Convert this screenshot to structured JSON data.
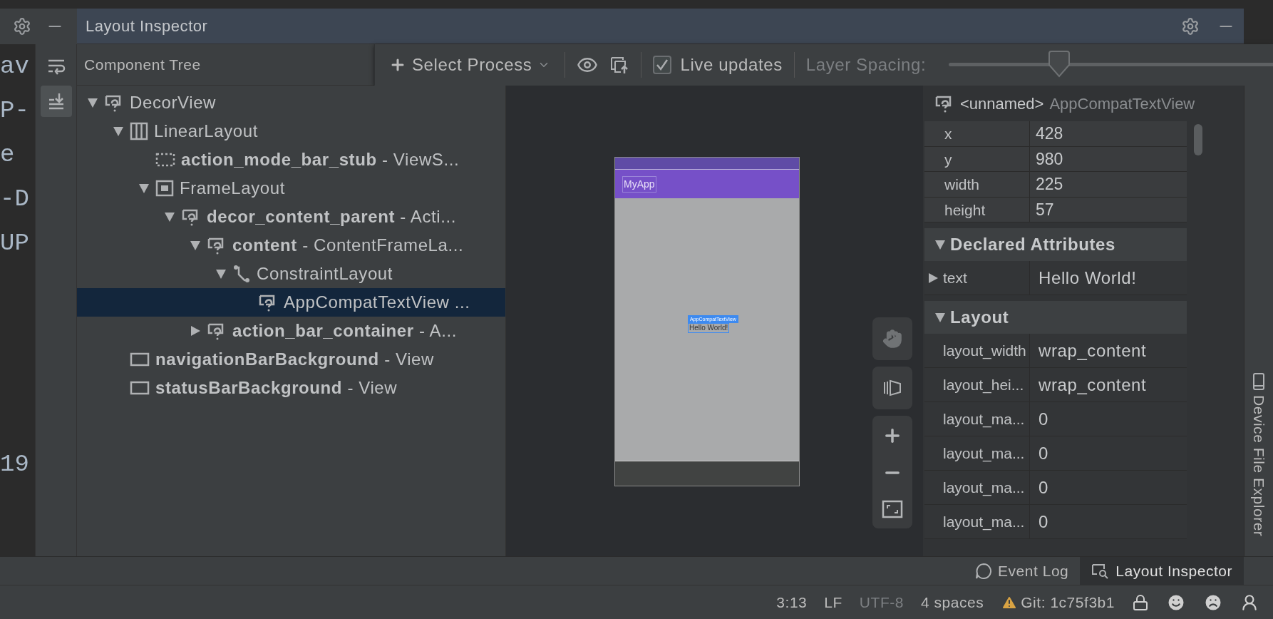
{
  "editor_fragments": [
    "av",
    "P-",
    "e",
    "-D",
    "UP",
    "19"
  ],
  "panel_title": "Layout Inspector",
  "component_tree": {
    "title": "Component Tree",
    "nodes": [
      {
        "label": "DecorView",
        "kind": "view",
        "expanded": true,
        "selected": false,
        "children": [
          {
            "label": "LinearLayout",
            "kind": "linear",
            "expanded": true,
            "selected": false,
            "children": [
              {
                "label": "**action_mode_bar_stub** - ViewS...",
                "kind": "stub",
                "selected": false
              },
              {
                "label": "FrameLayout",
                "kind": "frame",
                "expanded": true,
                "selected": false,
                "children": [
                  {
                    "label": "**decor_content_parent** - Acti...",
                    "kind": "view",
                    "expanded": true,
                    "selected": false,
                    "children": [
                      {
                        "label": "**content** - ContentFrameLa...",
                        "kind": "view",
                        "expanded": true,
                        "selected": false,
                        "children": [
                          {
                            "label": "ConstraintLayout",
                            "kind": "constraint",
                            "expanded": true,
                            "selected": false,
                            "children": [
                              {
                                "label": "AppCompatTextView ...",
                                "kind": "view",
                                "selected": true
                              }
                            ]
                          }
                        ]
                      },
                      {
                        "label": "**action_bar_container** - A...",
                        "kind": "view",
                        "expanded": false,
                        "selected": false
                      }
                    ]
                  }
                ]
              }
            ]
          },
          {
            "label": "**navigationBarBackground** - View",
            "kind": "rect",
            "selected": false
          },
          {
            "label": "**statusBarBackground** - View",
            "kind": "rect",
            "selected": false
          }
        ]
      }
    ]
  },
  "toolbar": {
    "select_process": "Select Process",
    "live_updates": {
      "label": "Live updates",
      "checked": true
    },
    "layer_spacing": {
      "label": "Layer Spacing:",
      "level": 0.3
    }
  },
  "device": {
    "app_title": "MyApp",
    "selection_tag": "AppCompatTextView",
    "text": "Hello World!"
  },
  "properties": {
    "header_id": "<unnamed>",
    "header_class": "AppCompatTextView",
    "rows": [
      {
        "name": "x",
        "value": "428"
      },
      {
        "name": "y",
        "value": "980"
      },
      {
        "name": "width",
        "value": "225"
      },
      {
        "name": "height",
        "value": "57"
      }
    ],
    "sections": [
      {
        "title": "Declared Attributes",
        "expanded": true,
        "rows": [
          {
            "name": "text",
            "value": "Hello World!",
            "expandable": true
          }
        ]
      },
      {
        "title": "Layout",
        "expanded": true,
        "rows": [
          {
            "name": "layout_width",
            "value": "wrap_content"
          },
          {
            "name": "layout_hei...",
            "value": "wrap_content"
          },
          {
            "name": "layout_ma...",
            "value": "0"
          },
          {
            "name": "layout_ma...",
            "value": "0"
          },
          {
            "name": "layout_ma...",
            "value": "0"
          },
          {
            "name": "layout_ma...",
            "value": "0"
          }
        ]
      }
    ]
  },
  "side_tab": "Device File Explorer",
  "bottom_tabs": [
    {
      "label": "Event Log",
      "kind": "bubble",
      "selected": false
    },
    {
      "label": "Layout Inspector",
      "kind": "inspector",
      "selected": true
    }
  ],
  "status_bar": {
    "position": "3:13",
    "line_separator": "LF",
    "encoding": "UTF-8",
    "indent": "4 spaces",
    "git": "Git: 1c75f3b1"
  }
}
